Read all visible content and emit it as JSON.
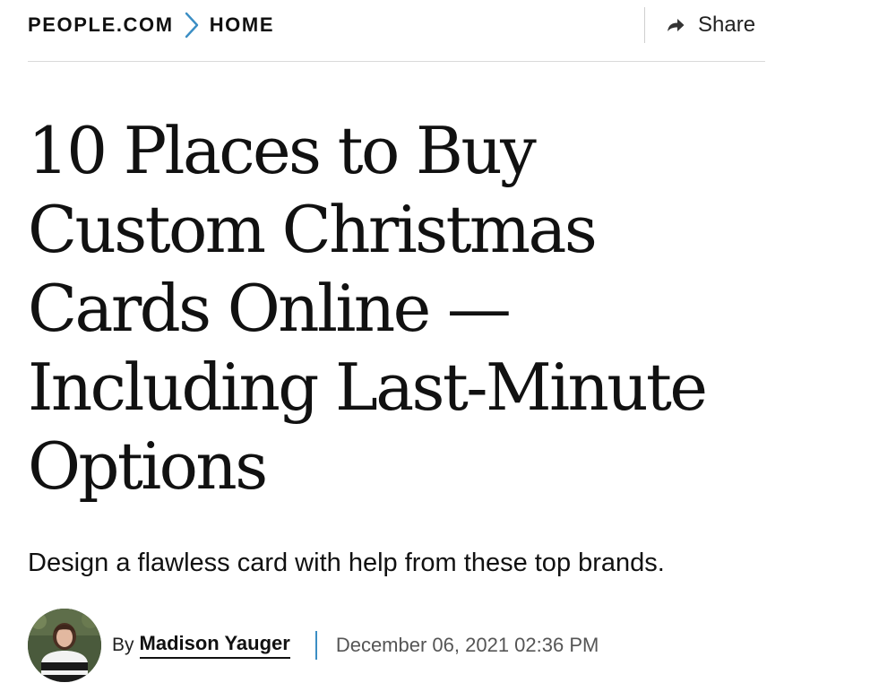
{
  "breadcrumb": {
    "items": [
      {
        "label": "PEOPLE.COM"
      },
      {
        "label": "HOME"
      }
    ],
    "separator_icon": "chevron-right-icon",
    "separator_color": "#3b8ec4"
  },
  "share": {
    "label": "Share",
    "icon": "share-arrow-icon"
  },
  "article": {
    "headline": "10 Places to Buy Custom Christmas Cards Online — Including Last-Minute Options",
    "deck": "Design a flawless card with help from these top brands.",
    "byline": {
      "prefix": "By",
      "author": "Madison Yauger",
      "date": "December 06, 2021 02:36 PM",
      "separator_color": "#3b8ec4"
    }
  },
  "colors": {
    "text": "#111111",
    "rule": "#d9d9d9",
    "accent": "#3b8ec4",
    "muted": "#555555"
  }
}
